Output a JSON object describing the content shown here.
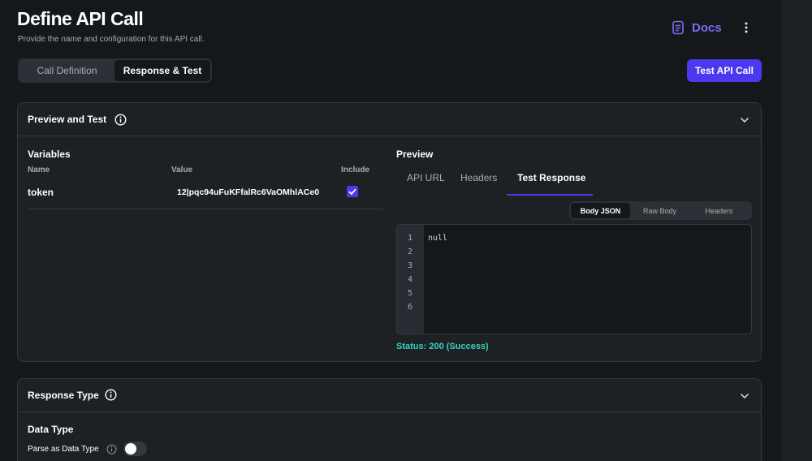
{
  "header": {
    "title": "Define API Call",
    "subtitle": "Provide the name and configuration for this API call.",
    "docs_label": "Docs"
  },
  "tabs": [
    {
      "label": "Call Definition",
      "active": false
    },
    {
      "label": "Response & Test",
      "active": true
    }
  ],
  "test_button": "Test API Call",
  "preview_test": {
    "title": "Preview and Test",
    "variables": {
      "title": "Variables",
      "columns": {
        "name": "Name",
        "value": "Value",
        "include": "Include"
      },
      "rows": [
        {
          "name": "token",
          "value": "12|pqc94uFuKFfalRc6VaOMhlACe0",
          "include": true
        }
      ]
    },
    "preview": {
      "title": "Preview",
      "tabs": [
        "API URL",
        "Headers",
        "Test Response"
      ],
      "active_tab": "Test Response",
      "body_tabs": [
        "Body JSON",
        "Raw Body",
        "Headers"
      ],
      "active_body_tab": "Body JSON",
      "line_numbers": [
        "1",
        "2",
        "3",
        "4",
        "5",
        "6"
      ],
      "code": "null",
      "status": "Status:  200 (Success)"
    }
  },
  "response_type": {
    "title": "Response Type",
    "data_type_label": "Data Type",
    "parse_label": "Parse as Data Type",
    "parse_enabled": false
  },
  "colors": {
    "accent": "#4b39ef",
    "success": "#39d2c0",
    "background": "#14181b",
    "surface": "#1d2124"
  },
  "icons": [
    "docs-icon",
    "more-vertical-icon",
    "info-icon",
    "chevron-down-icon",
    "check-icon"
  ]
}
